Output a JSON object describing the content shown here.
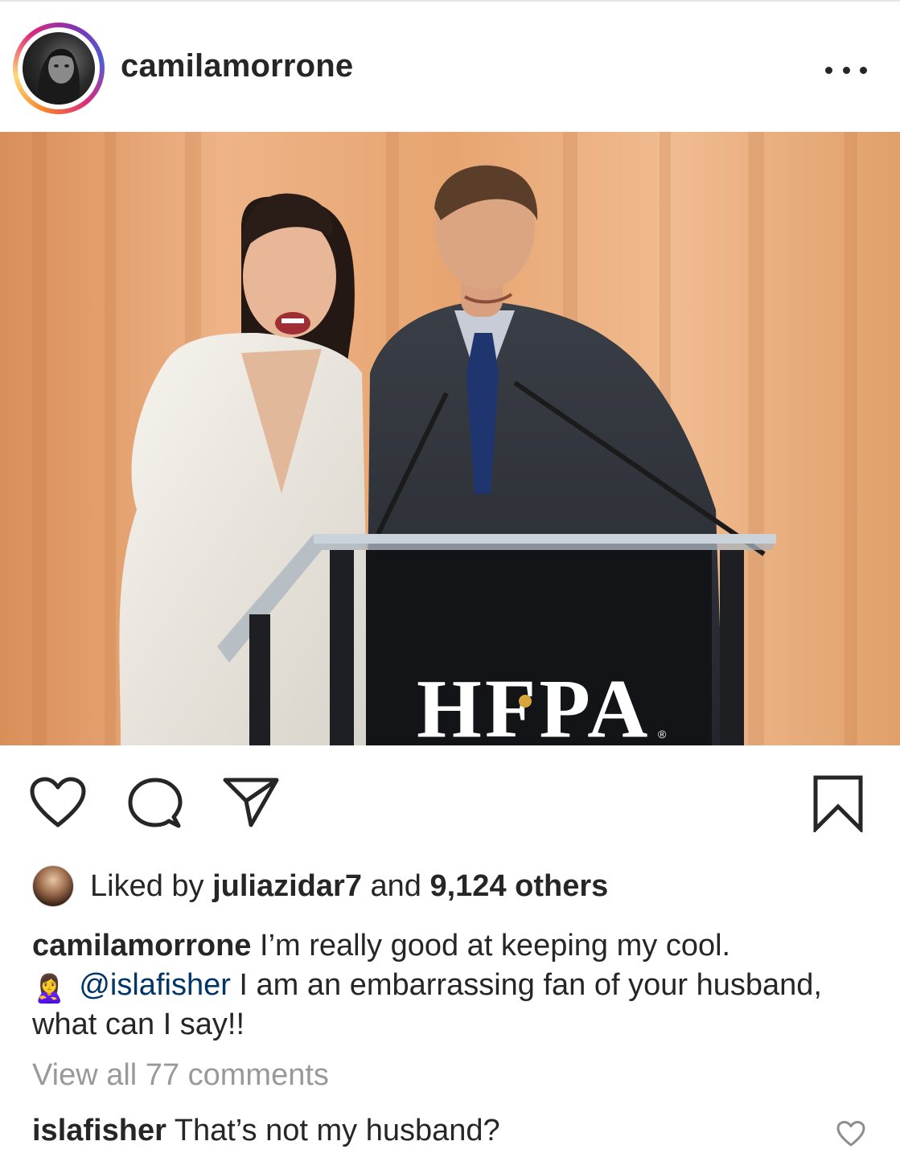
{
  "header": {
    "username": "camilamorrone"
  },
  "photo": {
    "podium_logo": "HFPA",
    "trademark": "®"
  },
  "actions": {
    "icons": [
      "heart-icon",
      "comment-icon",
      "share-icon",
      "bookmark-icon"
    ]
  },
  "likes": {
    "prefix": "Liked by",
    "user": "juliazidar7",
    "connector": "and",
    "count": "9,124 others"
  },
  "caption": {
    "username": "camilamorrone",
    "text_line1": "I’m really good at keeping my cool.",
    "emoji": "🙎‍♀️",
    "mention": "@islafisher",
    "text_rest": "I am an embarrassing fan of your husband, what can I say!!"
  },
  "comments": {
    "view_all": "View all 77 comments",
    "items": [
      {
        "username": "islafisher",
        "text": "That’s not my husband?"
      }
    ]
  },
  "colors": {
    "text": "#262626",
    "muted": "#999999",
    "mention": "#003569",
    "curtain": "#e9a676"
  }
}
